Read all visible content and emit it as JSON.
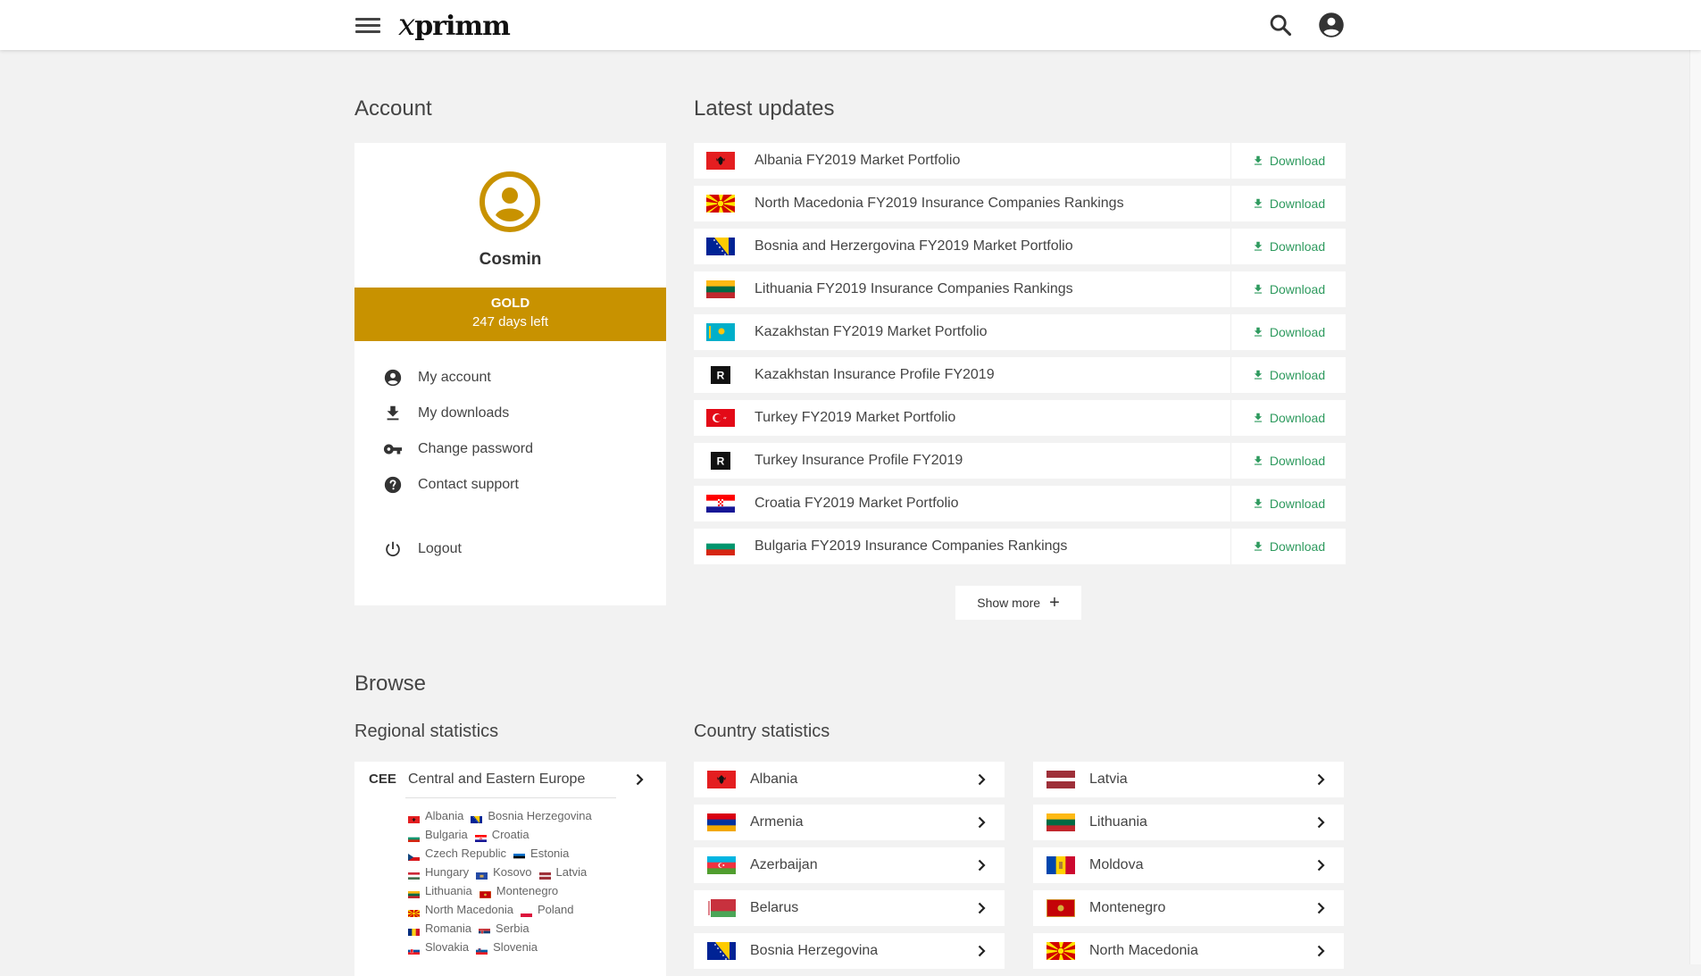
{
  "header": {
    "logo_x": "x",
    "logo_text": "primm",
    "menu_icon": "hamburger-icon",
    "search_icon": "search-icon",
    "account_icon": "account-circle-icon"
  },
  "account": {
    "section_title": "Account",
    "user_name": "Cosmin",
    "tier": "GOLD",
    "days_left": "247 days left",
    "menu": [
      {
        "label": "My account",
        "icon": "account-circle-icon"
      },
      {
        "label": "My downloads",
        "icon": "download-icon"
      },
      {
        "label": "Change password",
        "icon": "key-icon"
      },
      {
        "label": "Contact support",
        "icon": "help-icon"
      },
      {
        "label": "Logout",
        "icon": "power-icon"
      }
    ]
  },
  "updates": {
    "section_title": "Latest updates",
    "download_label": "Download",
    "show_more_label": "Show more",
    "items": [
      {
        "title": "Albania FY2019 Market Portfolio",
        "flag": "albania"
      },
      {
        "title": "North Macedonia FY2019 Insurance Companies Rankings",
        "flag": "north-macedonia"
      },
      {
        "title": "Bosnia and Herzergovina FY2019 Market Portfolio",
        "flag": "bosnia"
      },
      {
        "title": "Lithuania FY2019 Insurance Companies Rankings",
        "flag": "lithuania"
      },
      {
        "title": "Kazakhstan FY2019 Market Portfolio",
        "flag": "kazakhstan"
      },
      {
        "title": "Kazakhstan Insurance Profile FY2019",
        "flag": "r-badge"
      },
      {
        "title": "Turkey FY2019 Market Portfolio",
        "flag": "turkey"
      },
      {
        "title": "Turkey Insurance Profile FY2019",
        "flag": "r-badge"
      },
      {
        "title": "Croatia FY2019 Market Portfolio",
        "flag": "croatia"
      },
      {
        "title": "Bulgaria FY2019 Insurance Companies Rankings",
        "flag": "bulgaria"
      }
    ],
    "r_badge_letter": "R"
  },
  "browse": {
    "section_title": "Browse",
    "regional_title": "Regional statistics",
    "country_title": "Country statistics",
    "region": {
      "code": "CEE",
      "name": "Central and Eastern Europe",
      "countries": [
        [
          "Albania",
          "Bosnia Herzegovina"
        ],
        [
          "Bulgaria",
          "Croatia"
        ],
        [
          "Czech Republic",
          "Estonia"
        ],
        [
          "Hungary",
          "Kosovo",
          "Latvia"
        ],
        [
          "Lithuania",
          "Montenegro"
        ],
        [
          "North Macedonia",
          "Poland"
        ],
        [
          "Romania",
          "Serbia"
        ],
        [
          "Slovakia",
          "Slovenia"
        ]
      ]
    },
    "countries_left": [
      "Albania",
      "Armenia",
      "Azerbaijan",
      "Belarus",
      "Bosnia Herzegovina"
    ],
    "countries_right": [
      "Latvia",
      "Lithuania",
      "Moldova",
      "Montenegro",
      "North Macedonia"
    ]
  },
  "colors": {
    "gold": "#c89200",
    "download_green": "#2e9a5e",
    "background": "#f2f2f2"
  }
}
